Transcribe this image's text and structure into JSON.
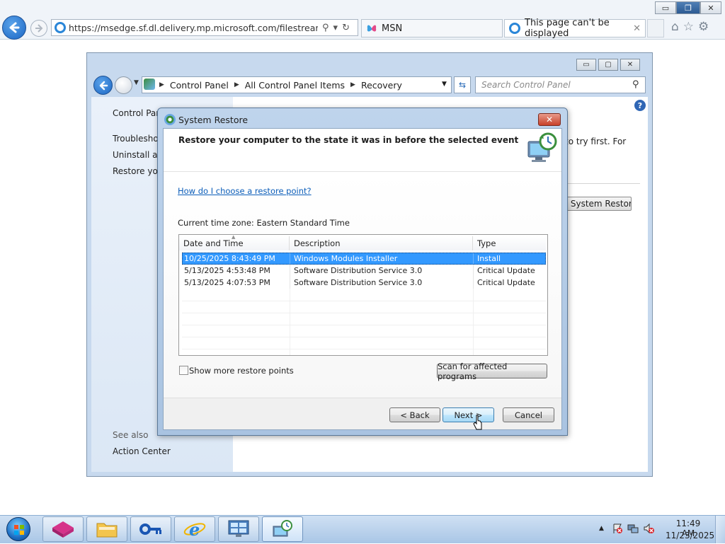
{
  "browser": {
    "address": "https://msedge.sf.dl.delivery.mp.microsoft.com/filestreamingservic",
    "tabs": [
      {
        "label": "MSN"
      },
      {
        "label": "This page can't be displayed"
      }
    ],
    "window_controls": {
      "minimize": "▭",
      "maximize": "❐",
      "close": "✕"
    }
  },
  "control_panel": {
    "breadcrumb": [
      "Control Panel",
      "All Control Panel Items",
      "Recovery"
    ],
    "search_placeholder": "Search Control Panel",
    "left_nav": {
      "home": "Control Panel Home",
      "items": [
        "Troubleshoot problems",
        "Uninstall a program",
        "Restore your computer"
      ],
      "see_also": "See also",
      "action_center": "Action Center"
    },
    "right_text": "to try first. For",
    "open_button": "Open System Restore"
  },
  "system_restore": {
    "title": "System Restore",
    "heading": "Restore your computer to the state it was in before the selected event",
    "link": "How do I choose a restore point?",
    "timezone": "Current time zone: Eastern Standard Time",
    "columns": [
      "Date and Time",
      "Description",
      "Type"
    ],
    "rows": [
      {
        "date": "10/25/2025 8:43:49 PM",
        "description": "Windows Modules Installer",
        "type": "Install",
        "selected": true
      },
      {
        "date": "5/13/2025 4:53:48 PM",
        "description": "Software Distribution Service 3.0",
        "type": "Critical Update",
        "selected": false
      },
      {
        "date": "5/13/2025 4:07:53 PM",
        "description": "Software Distribution Service 3.0",
        "type": "Critical Update",
        "selected": false
      }
    ],
    "show_more_label": "Show more restore points",
    "scan_button": "Scan for affected programs",
    "back_button": "< Back",
    "next_button": "Next >",
    "cancel_button": "Cancel"
  },
  "taskbar": {
    "time": "11:49 AM",
    "date": "11/23/2025"
  },
  "colors": {
    "selection": "#3399ff",
    "link": "#0b5db9",
    "accent_blue": "#1b66c4"
  }
}
